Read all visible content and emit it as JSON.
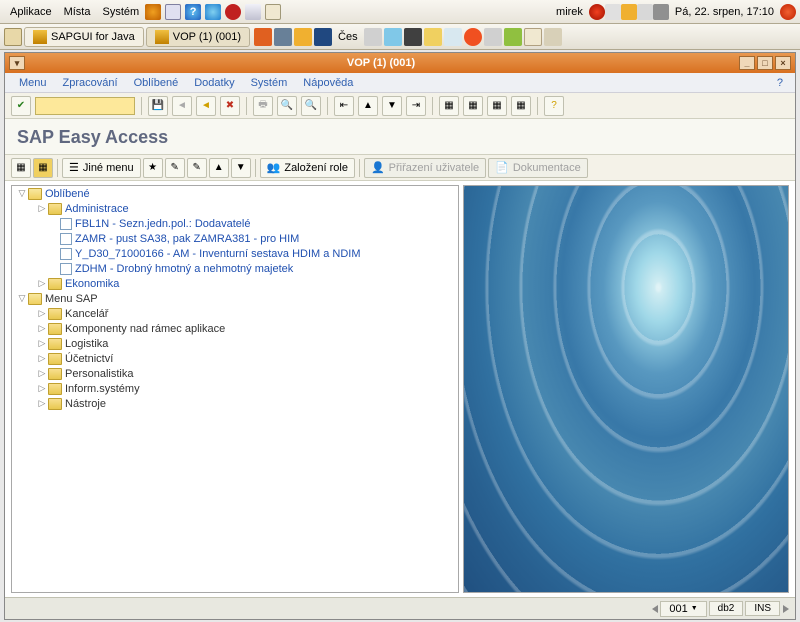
{
  "gnome": {
    "apps": "Aplikace",
    "places": "Místa",
    "system": "Systém",
    "user": "mirek",
    "clock": "Pá, 22. srpen, 17:10"
  },
  "taskbar": {
    "task1": "SAPGUI for Java",
    "task2": "VOP (1) (001)",
    "lang": "Čes"
  },
  "window": {
    "title": "VOP (1) (001)"
  },
  "menubar": {
    "menu": "Menu",
    "edit": "Zpracování",
    "favorites": "Oblíbené",
    "extras": "Dodatky",
    "system": "Systém",
    "help": "Nápověda",
    "qmark": "?"
  },
  "sap_title": "SAP Easy Access",
  "appbar": {
    "other_menu": "Jiné menu",
    "create_role": "Založení role",
    "assign_users": "Přiřazení uživatele",
    "documentation": "Dokumentace"
  },
  "tree": {
    "favorites": "Oblíbené",
    "admin": "Administrace",
    "fbl1n": "FBL1N - Sezn.jedn.pol.: Dodavatelé",
    "zamr": "ZAMR - pust SA38, pak ZAMRA381 - pro HIM",
    "yd30": "Y_D30_71000166 - AM - Inventurní sestava HDIM a NDIM",
    "zdhm": "ZDHM - Drobný hmotný a nehmotný majetek",
    "ekon": "Ekonomika",
    "menu_sap": "Menu SAP",
    "kancelar": "Kancelář",
    "komponenty": "Komponenty nad rámec aplikace",
    "logistika": "Logistika",
    "ucetnictvi": "Účetnictví",
    "personalistika": "Personalistika",
    "infosys": "Inform.systémy",
    "nastroje": "Nástroje"
  },
  "status": {
    "client": "001",
    "db": "db2",
    "mode": "INS"
  }
}
